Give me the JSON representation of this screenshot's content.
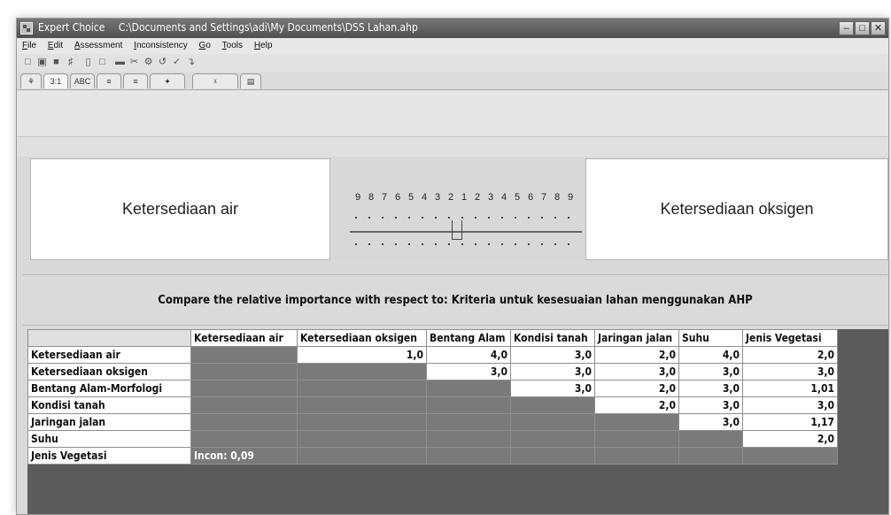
{
  "titlebar": {
    "app": "Expert Choice",
    "path": "C:\\Documents and Settings\\adi\\My Documents\\DSS Lahan.ahp",
    "min_icon": "minimize-icon",
    "max_icon": "maximize-icon",
    "close_icon": "close-icon"
  },
  "menu": [
    "File",
    "Edit",
    "Assessment",
    "Inconsistency",
    "Go",
    "Tools",
    "Help"
  ],
  "tabs": [
    {
      "label": "⚘",
      "icon": "tree-icon"
    },
    {
      "label": "3:1",
      "icon": "numerical-icon"
    },
    {
      "label": "ABC",
      "icon": "verbal-icon"
    },
    {
      "label": "≡",
      "icon": "graphical-icon"
    },
    {
      "label": "≡",
      "icon": "questionnaire-icon"
    },
    {
      "label": "✦",
      "icon": "ratings-icon"
    },
    {
      "label": "ᵡ",
      "icon": "formula-icon"
    },
    {
      "label": "▤",
      "icon": "data-icon"
    }
  ],
  "compare": {
    "left": "Ketersediaan air",
    "right": "Ketersediaan oksigen",
    "scale": [
      "9",
      "8",
      "7",
      "6",
      "5",
      "4",
      "3",
      "2",
      "1",
      "2",
      "3",
      "4",
      "5",
      "6",
      "7",
      "8",
      "9"
    ],
    "slider_value": 1,
    "instruction": "Compare the relative importance with respect to: Kriteria untuk kesesuaian lahan menggunakan AHP"
  },
  "matrix": {
    "columns": [
      "Ketersediaan air",
      "Ketersediaan oksigen",
      "Bentang Alam",
      "Kondisi tanah",
      "Jaringan jalan",
      "Suhu",
      "Jenis Vegetasi"
    ],
    "rows": [
      {
        "label": "Ketersediaan air",
        "cells": [
          "",
          "1,0",
          "4,0",
          "3,0",
          "2,0",
          "4,0",
          "2,0"
        ]
      },
      {
        "label": "Ketersediaan oksigen",
        "cells": [
          "",
          "",
          "3,0",
          "3,0",
          "3,0",
          "3,0",
          "3,0"
        ]
      },
      {
        "label": "Bentang Alam-Morfologi",
        "cells": [
          "",
          "",
          "",
          "3,0",
          "2,0",
          "3,0",
          "1,01"
        ]
      },
      {
        "label": "Kondisi tanah",
        "cells": [
          "",
          "",
          "",
          "",
          "2,0",
          "3,0",
          "3,0"
        ]
      },
      {
        "label": "Jaringan jalan",
        "cells": [
          "",
          "",
          "",
          "",
          "",
          "3,0",
          "1,17"
        ]
      },
      {
        "label": "Suhu",
        "cells": [
          "",
          "",
          "",
          "",
          "",
          "",
          "2,0"
        ]
      },
      {
        "label": "Jenis Vegetasi",
        "cells": [
          "Incon: 0,09",
          "",
          "",
          "",
          "",
          "",
          ""
        ]
      }
    ]
  }
}
